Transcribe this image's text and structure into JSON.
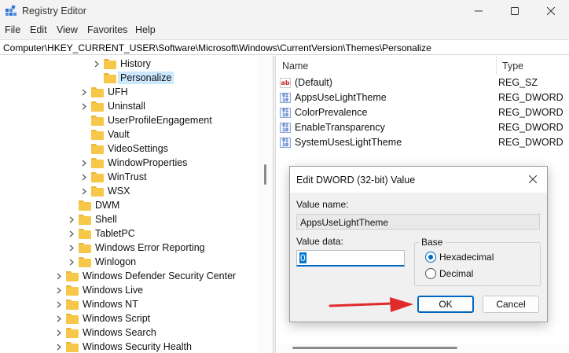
{
  "window": {
    "title": "Registry Editor",
    "controls": {
      "minimize": "minimize",
      "maximize": "maximize",
      "close": "close"
    }
  },
  "menu": [
    "File",
    "Edit",
    "View",
    "Favorites",
    "Help"
  ],
  "address": "Computer\\HKEY_CURRENT_USER\\Software\\Microsoft\\Windows\\CurrentVersion\\Themes\\Personalize",
  "tree": [
    {
      "label": "History",
      "level": 3,
      "expandable": true
    },
    {
      "label": "Personalize",
      "level": 3,
      "expandable": false,
      "selected": true
    },
    {
      "label": "UFH",
      "level": 2,
      "expandable": true
    },
    {
      "label": "Uninstall",
      "level": 2,
      "expandable": true
    },
    {
      "label": "UserProfileEngagement",
      "level": 2,
      "expandable": false
    },
    {
      "label": "Vault",
      "level": 2,
      "expandable": false
    },
    {
      "label": "VideoSettings",
      "level": 2,
      "expandable": false
    },
    {
      "label": "WindowProperties",
      "level": 2,
      "expandable": true
    },
    {
      "label": "WinTrust",
      "level": 2,
      "expandable": true
    },
    {
      "label": "WSX",
      "level": 2,
      "expandable": true
    },
    {
      "label": "DWM",
      "level": 1,
      "expandable": false
    },
    {
      "label": "Shell",
      "level": 1,
      "expandable": true
    },
    {
      "label": "TabletPC",
      "level": 1,
      "expandable": true
    },
    {
      "label": "Windows Error Reporting",
      "level": 1,
      "expandable": true
    },
    {
      "label": "Winlogon",
      "level": 1,
      "expandable": true
    },
    {
      "label": "Windows Defender Security Center",
      "level": 0,
      "expandable": true
    },
    {
      "label": "Windows Live",
      "level": 0,
      "expandable": true
    },
    {
      "label": "Windows NT",
      "level": 0,
      "expandable": true
    },
    {
      "label": "Windows Script",
      "level": 0,
      "expandable": true
    },
    {
      "label": "Windows Search",
      "level": 0,
      "expandable": true
    },
    {
      "label": "Windows Security Health",
      "level": 0,
      "expandable": true
    }
  ],
  "list": {
    "headers": {
      "name": "Name",
      "type": "Type"
    },
    "rows": [
      {
        "name": "(Default)",
        "type": "REG_SZ",
        "icon": "string-value-icon"
      },
      {
        "name": "AppsUseLightTheme",
        "type": "REG_DWORD",
        "icon": "dword-value-icon"
      },
      {
        "name": "ColorPrevalence",
        "type": "REG_DWORD",
        "icon": "dword-value-icon"
      },
      {
        "name": "EnableTransparency",
        "type": "REG_DWORD",
        "icon": "dword-value-icon"
      },
      {
        "name": "SystemUsesLightTheme",
        "type": "REG_DWORD",
        "icon": "dword-value-icon"
      }
    ]
  },
  "dialog": {
    "title": "Edit DWORD (32-bit) Value",
    "value_name_label": "Value name:",
    "value_name": "AppsUseLightTheme",
    "value_data_label": "Value data:",
    "value_data": "0",
    "base_label": "Base",
    "hex_label": "Hexadecimal",
    "dec_label": "Decimal",
    "base_selected": "Hexadecimal",
    "ok": "OK",
    "cancel": "Cancel"
  },
  "colors": {
    "accent": "#0067c0",
    "annotation_arrow": "#e02b2b",
    "folder": "#f6c748"
  }
}
